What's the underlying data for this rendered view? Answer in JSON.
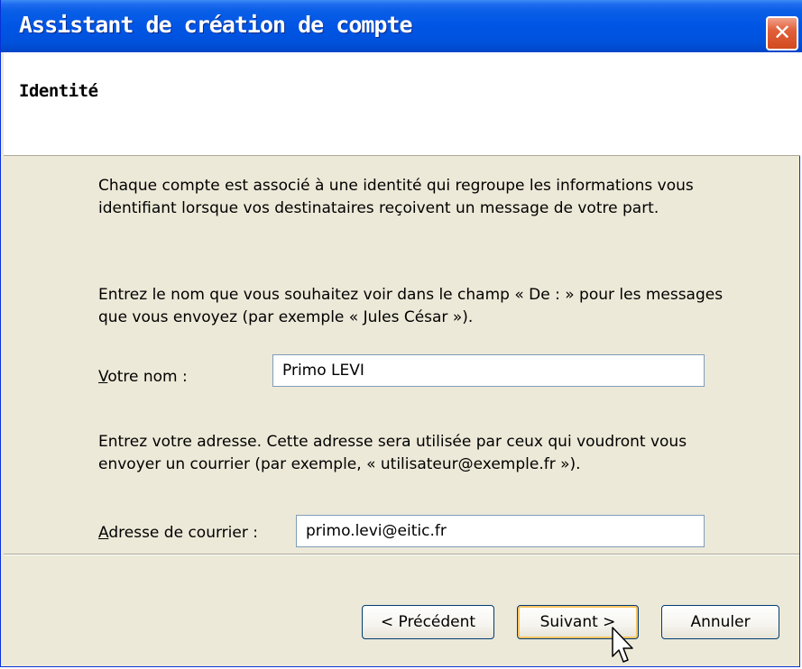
{
  "window": {
    "title": "Assistant de création de compte",
    "close_glyph": "✕"
  },
  "header": {
    "title": "Identité"
  },
  "content": {
    "intro_text": "Chaque compte est associé à une identité qui regroupe les informations vous identifiant lorsque vos destinataires reçoivent un message de votre part.",
    "name_instructions": "Entrez le nom que vous souhaitez voir dans le champ « De : » pour les messages que vous envoyez (par exemple « Jules César »).",
    "name_label_first": "V",
    "name_label_rest": "otre nom :",
    "name_value": "Primo LEVI",
    "email_instructions": "Entrez votre adresse. Cette adresse sera utilisée par ceux qui voudront vous envoyer un courrier (par exemple, « utilisateur@exemple.fr »).",
    "email_label_first": "A",
    "email_label_rest": "dresse de courrier :",
    "email_value": "primo.levi@eitic.fr"
  },
  "buttons": {
    "previous": "< Précédent",
    "next": "Suivant >",
    "cancel": "Annuler"
  },
  "colors": {
    "titlebar": "#0055e5",
    "dialog_bg": "#ece9d8",
    "close_button": "#d24a20",
    "default_button_focus": "#f9c361"
  },
  "icons": {
    "close": "close-icon",
    "pointer": "mouse-pointer-icon"
  }
}
